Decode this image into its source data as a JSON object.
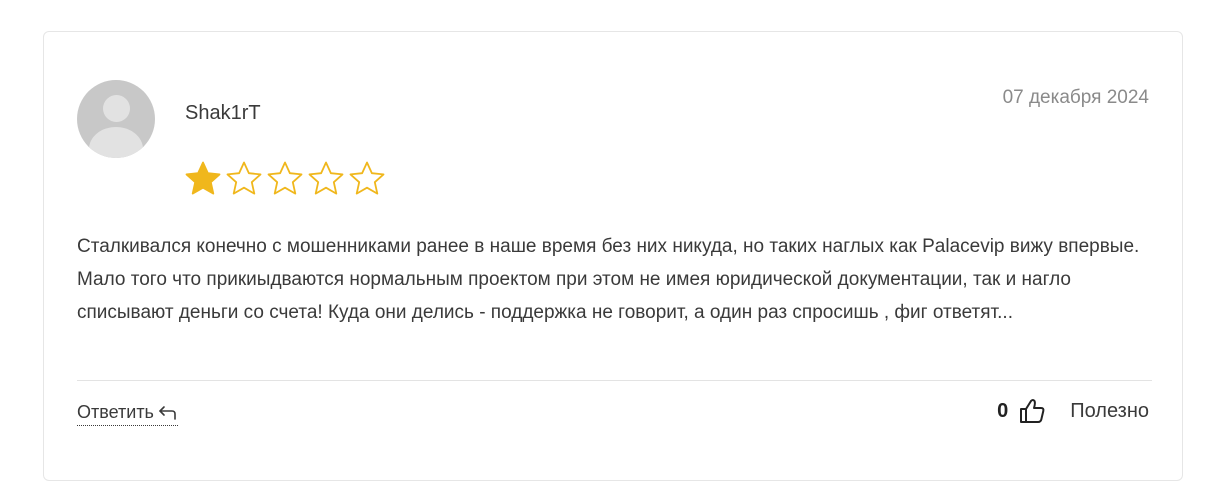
{
  "review": {
    "author": "Shak1rT",
    "date": "07 декабря 2024",
    "rating": 1,
    "rating_max": 5,
    "text": "Сталкивался конечно с мошенниками ранее в наше время без них никуда, но таких наглых как Palacevip вижу впервые. Мало того что прикиыдваются нормальным проектом при этом не имея юридической документации, так и нагло списывают деньги со счета! Куда они делись - поддержка не говорит, а один раз спросишь , фиг ответят...",
    "reply_label": "Ответить",
    "helpful_count": "0",
    "helpful_label": "Полезно"
  },
  "colors": {
    "star_filled": "#f0b71c",
    "star_empty_stroke": "#f0b71c",
    "avatar_bg": "#c8c8c8"
  },
  "icons": {
    "avatar": "user-avatar-icon",
    "reply": "reply-arrow-icon",
    "helpful": "thumbs-up-icon",
    "star": "star-icon"
  }
}
